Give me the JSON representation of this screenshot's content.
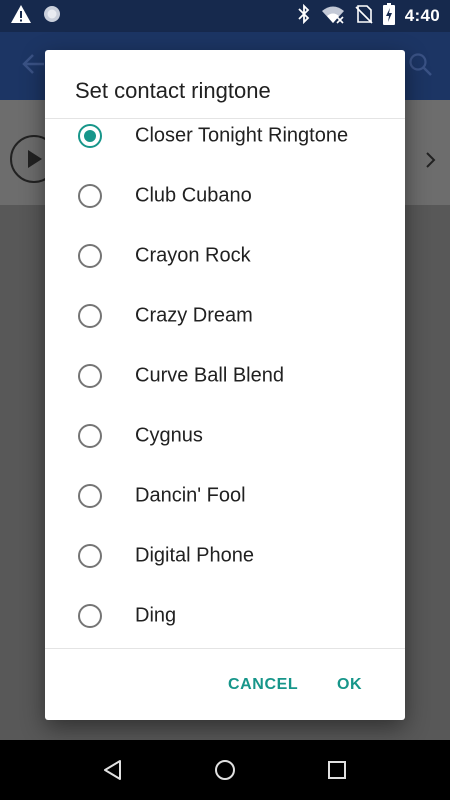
{
  "status_bar": {
    "time": "4:40",
    "left_icons": [
      "warning-icon",
      "sync-circle-icon"
    ],
    "right_icons": [
      "bluetooth-icon",
      "wifi-icon",
      "no-sim-icon",
      "battery-charging-icon"
    ]
  },
  "dialog": {
    "title": "Set contact ringtone",
    "options": [
      {
        "label": "Closer Tonight Ringtone",
        "selected": true
      },
      {
        "label": "Club Cubano",
        "selected": false
      },
      {
        "label": "Crayon Rock",
        "selected": false
      },
      {
        "label": "Crazy Dream",
        "selected": false
      },
      {
        "label": "Curve Ball Blend",
        "selected": false
      },
      {
        "label": "Cygnus",
        "selected": false
      },
      {
        "label": "Dancin' Fool",
        "selected": false
      },
      {
        "label": "Digital Phone",
        "selected": false
      },
      {
        "label": "Ding",
        "selected": false
      }
    ],
    "cancel_label": "CANCEL",
    "ok_label": "OK"
  },
  "navigation_bar": {
    "icons": [
      "back-icon",
      "home-icon",
      "recents-icon"
    ]
  },
  "colors": {
    "accent": "#17968a",
    "status_bar": "#16294d",
    "app_bar": "#1c3564"
  }
}
